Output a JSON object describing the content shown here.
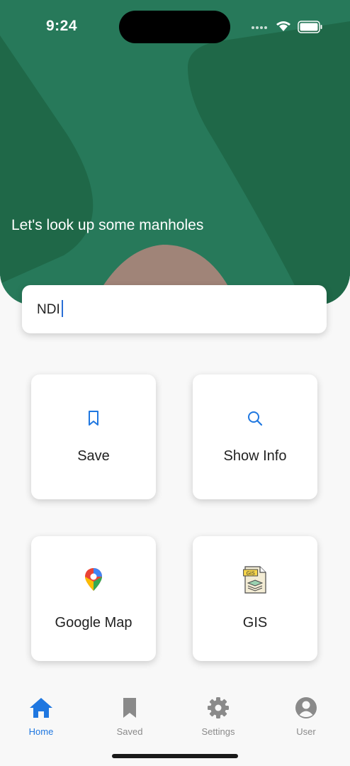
{
  "status_bar": {
    "time": "9:24"
  },
  "header": {
    "tagline": "Let's look up some manholes"
  },
  "search": {
    "value": "NDI"
  },
  "tiles": [
    {
      "label": "Save",
      "icon": "bookmark-icon"
    },
    {
      "label": "Show Info",
      "icon": "search-icon"
    },
    {
      "label": "Google Map",
      "icon": "map-pin-icon"
    },
    {
      "label": "GIS",
      "icon": "gis-file-icon"
    }
  ],
  "tabbar": {
    "items": [
      {
        "label": "Home",
        "icon": "home-icon",
        "active": true
      },
      {
        "label": "Saved",
        "icon": "bookmark-icon",
        "active": false
      },
      {
        "label": "Settings",
        "icon": "gear-icon",
        "active": false
      },
      {
        "label": "User",
        "icon": "user-icon",
        "active": false
      }
    ]
  },
  "colors": {
    "header_green": "#23724f",
    "accent_blue": "#1f77e0",
    "tan": "#a08478"
  }
}
